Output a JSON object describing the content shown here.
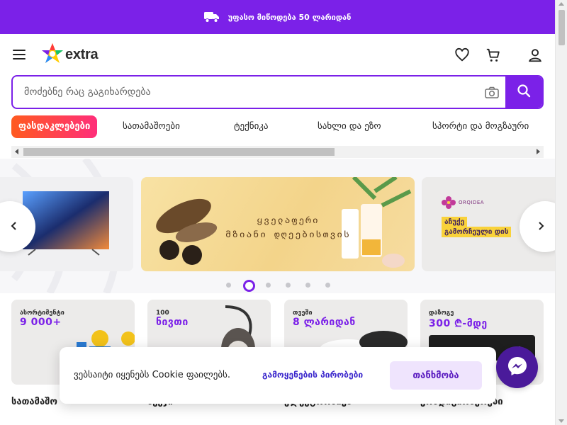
{
  "promo": {
    "text": "უფასო მიწოდება 50 ლარიდან",
    "icon": "truck-icon"
  },
  "header": {
    "logo_text": "extra",
    "icons": [
      "menu-icon",
      "heart-icon",
      "cart-icon",
      "user-icon"
    ]
  },
  "search": {
    "placeholder": "მოძებნე რაც გაგიხარდება",
    "icons": [
      "camera-icon",
      "search-icon"
    ]
  },
  "categories": [
    {
      "label": "ფასდაკლებები",
      "active": true
    },
    {
      "label": "სათამაშოები",
      "active": false
    },
    {
      "label": "ტექნიკა",
      "active": false
    },
    {
      "label": "სახლი და ეზო",
      "active": false
    },
    {
      "label": "სპორტი და მოგზაური",
      "active": false
    }
  ],
  "banners": {
    "main_title_line1": "ყველაფერი",
    "main_title_line2": "მზიანი დღეებისთვის",
    "right_brand": "ORQIDEA",
    "right_line1": "აჩუქე",
    "right_line2": "გამორჩეული დის",
    "active_slide": 2,
    "slide_count": 6
  },
  "cards": [
    {
      "small": "ასორტიმენტი",
      "big": "9 000+",
      "title": "სათამაშო"
    },
    {
      "small": "100",
      "big": "ნივთი",
      "title": "ავეჯი"
    },
    {
      "small": "თვეში",
      "big": "8 ლარიდან",
      "title": "ელექტრონიკა"
    },
    {
      "small": "დაზოგე",
      "big": "300 ₾-მდე",
      "title": "კონდიციონერები"
    }
  ],
  "cookie": {
    "text": "ვებსაიტი იყენებს Cookie ფაილებს.",
    "link": "გამოყენების პირობები",
    "agree": "თანხმობა"
  },
  "colors": {
    "brand": "#7b21e8",
    "sale_start": "#ff5a1f",
    "sale_end": "#ff2e7a"
  }
}
